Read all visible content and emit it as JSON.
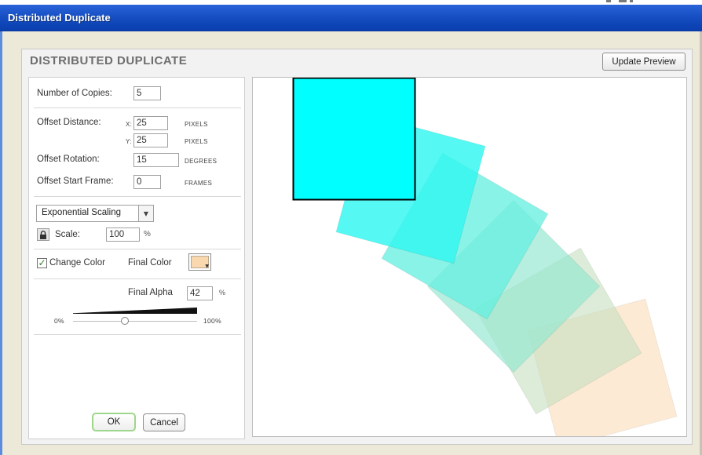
{
  "window": {
    "title": "Distributed Duplicate"
  },
  "dialog": {
    "heading": "DISTRIBUTED DUPLICATE",
    "update_preview_label": "Update Preview"
  },
  "copies": {
    "label": "Number of Copies:",
    "value": "5"
  },
  "offset_distance": {
    "label": "Offset Distance:",
    "x_label": "X:",
    "x_value": "25",
    "y_label": "Y:",
    "y_value": "25",
    "unit": "PIXELS"
  },
  "offset_rotation": {
    "label": "Offset Rotation:",
    "value": "15",
    "unit": "DEGREES"
  },
  "offset_start_frame": {
    "label": "Offset Start Frame:",
    "value": "0",
    "unit": "FRAMES"
  },
  "scaling": {
    "selected": "Exponential Scaling",
    "scale_label": "Scale:",
    "scale_value": "100",
    "unit": "%"
  },
  "color": {
    "change_color_label": "Change Color",
    "change_color_checked": true,
    "final_color_label": "Final Color",
    "final_color": "#f9d8b0",
    "start_color": "#00ffff"
  },
  "alpha": {
    "label": "Final Alpha",
    "value": "42",
    "unit": "%",
    "min_label": "0%",
    "max_label": "100%",
    "slider_fraction": 0.42
  },
  "buttons": {
    "ok": "OK",
    "cancel": "Cancel"
  },
  "icons": {
    "lock": "lock-icon",
    "dropdown": "chevron-down-icon",
    "check": "checkmark-icon"
  }
}
